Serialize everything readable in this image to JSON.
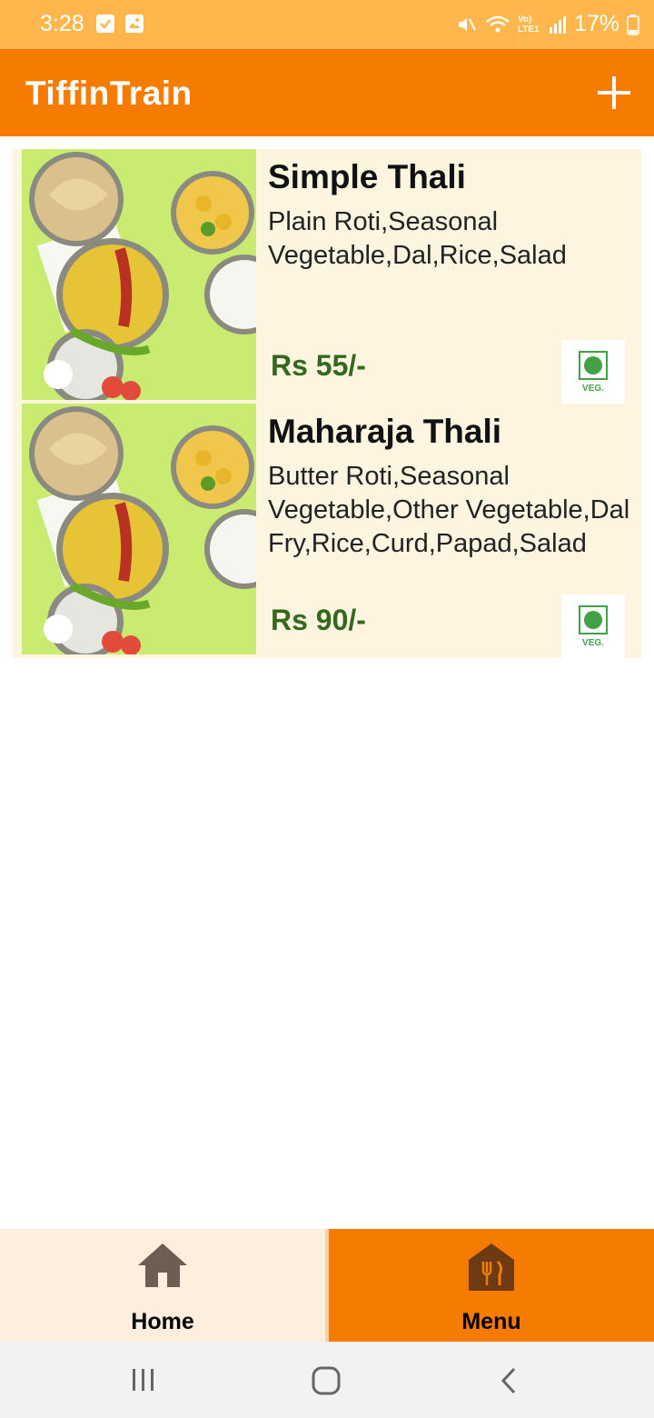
{
  "status_bar": {
    "time": "3:28",
    "battery": "17%",
    "network": "Vo) LTE1",
    "icons": [
      "check-square-icon",
      "image-icon",
      "mute-icon",
      "wifi-icon",
      "signal-icon",
      "battery-icon"
    ]
  },
  "app_bar": {
    "title": "TiffinTrain",
    "action_icon": "add-icon"
  },
  "menu_items": [
    {
      "name": "Simple Thali",
      "description": "Plain Roti,Seasonal Vegetable,Dal,Rice,Salad",
      "price": "Rs 55/-",
      "badge": "VEG."
    },
    {
      "name": "Maharaja Thali",
      "description": "Butter Roti,Seasonal Vegetable,Other Vegetable,Dal Fry,Rice,Curd,Papad,Salad",
      "price": "Rs 90/-",
      "badge": "VEG."
    }
  ],
  "bottom_nav": {
    "home_label": "Home",
    "menu_label": "Menu",
    "active": "Menu"
  },
  "colors": {
    "primary": "#f57c00",
    "status_bar": "#ffb74d",
    "card_background": "#fdf5e0",
    "price": "#33691e",
    "veg": "#43a047"
  }
}
